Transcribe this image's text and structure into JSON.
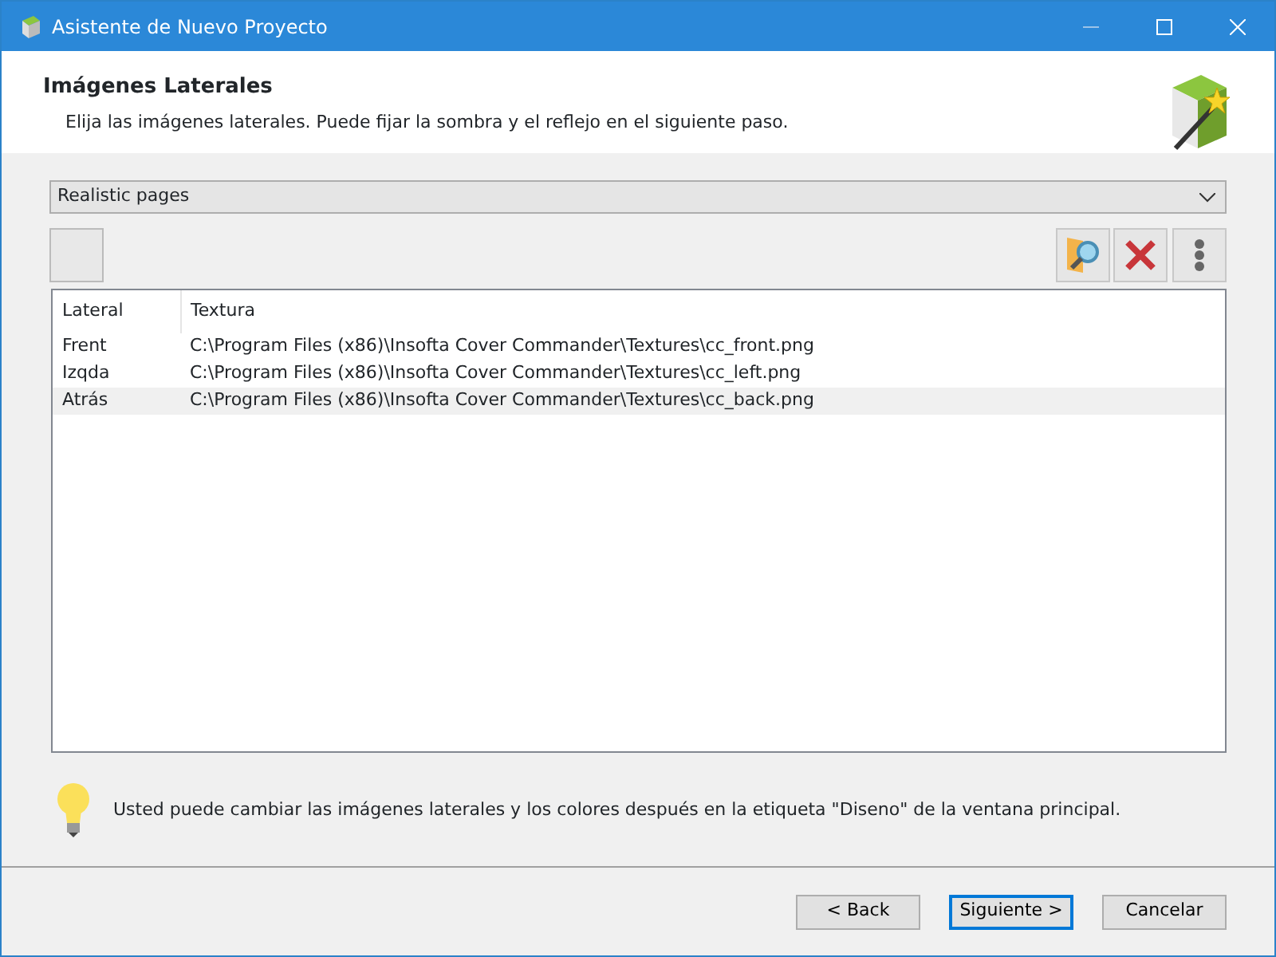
{
  "window": {
    "title": "Asistente de Nuevo Proyecto"
  },
  "header": {
    "title": "Imágenes Laterales",
    "subtitle": "Elija las imágenes laterales. Puede fijar la sombra y el reflejo en el siguiente paso."
  },
  "preset": {
    "value": "Realistic pages"
  },
  "table": {
    "columns": [
      "Lateral",
      "Textura"
    ],
    "rows": [
      {
        "cells": [
          "Frent",
          "C:\\Program Files (x86)\\Insofta Cover Commander\\Textures\\cc_front.png"
        ],
        "selected": false
      },
      {
        "cells": [
          "Izqda",
          "C:\\Program Files (x86)\\Insofta Cover Commander\\Textures\\cc_left.png"
        ],
        "selected": false
      },
      {
        "cells": [
          "Atrás",
          "C:\\Program Files (x86)\\Insofta Cover Commander\\Textures\\cc_back.png"
        ],
        "selected": true
      }
    ]
  },
  "hint": "Usted puede cambiar las imágenes laterales y los colores después en la etiqueta \"Diseno\" de la ventana principal.",
  "buttons": [
    {
      "label": "< Back",
      "default": false
    },
    {
      "label": "Siguiente >",
      "default": true
    },
    {
      "label": "Cancelar",
      "default": false
    }
  ]
}
